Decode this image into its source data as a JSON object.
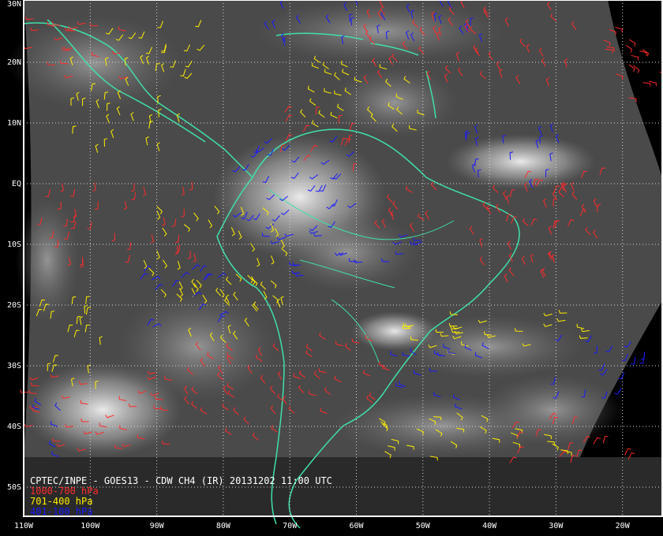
{
  "title": "CPTEC/INPE - GOES13 - CDW CH4 (IR) 20131202 11:00 UTC",
  "colors": {
    "background": "#000000",
    "frame": "#ffffff",
    "coast": "#3fe0a8",
    "grid": "#d8d8d8"
  },
  "layers": [
    {
      "label": "1000-700 hPa",
      "color": "#ff2a2a"
    },
    {
      "label": "701-400 hPa",
      "color": "#ffee00"
    },
    {
      "label": "401-100 hPa",
      "color": "#1a1aff"
    }
  ],
  "axes": {
    "lat_labels": [
      "30N",
      "20N",
      "10N",
      "EQ",
      "10S",
      "20S",
      "30S",
      "40S",
      "50S"
    ],
    "lon_labels": [
      "110W",
      "100W",
      "90W",
      "80W",
      "70W",
      "60W",
      "50W",
      "40W",
      "30W",
      "20W"
    ]
  }
}
